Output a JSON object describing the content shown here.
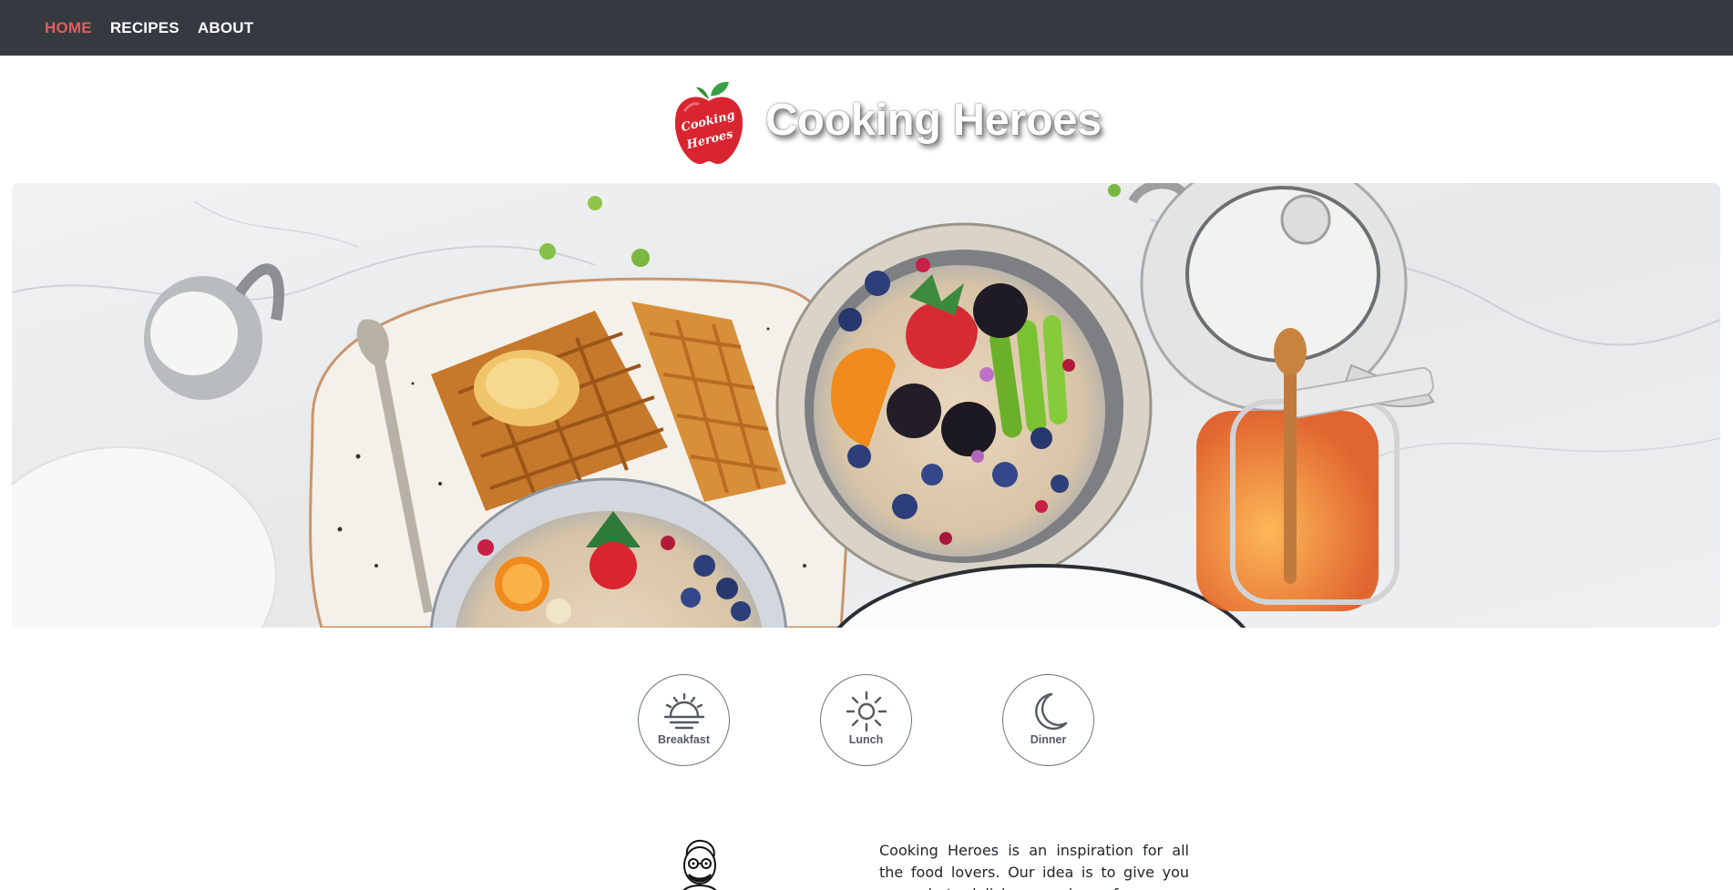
{
  "nav": {
    "items": [
      {
        "label": "HOME",
        "active": true
      },
      {
        "label": "RECIPES",
        "active": false
      },
      {
        "label": "ABOUT",
        "active": false
      }
    ]
  },
  "brand": {
    "title": "Cooking Heroes",
    "logo_text_line1": "Cooking",
    "logo_text_line2": "Heroes"
  },
  "meals": [
    {
      "label": "Breakfast",
      "icon": "sunrise-icon"
    },
    {
      "label": "Lunch",
      "icon": "sun-icon"
    },
    {
      "label": "Dinner",
      "icon": "moon-icon"
    }
  ],
  "about": {
    "text": "Cooking Heroes is an inspiration for all the food lovers. Our idea is to give you easy but delicious recipes for every occasion."
  },
  "colors": {
    "navbar_bg": "#343a40",
    "nav_active": "#e35d5b",
    "logo_red": "#d9252f",
    "leaf_green": "#3aa045"
  }
}
